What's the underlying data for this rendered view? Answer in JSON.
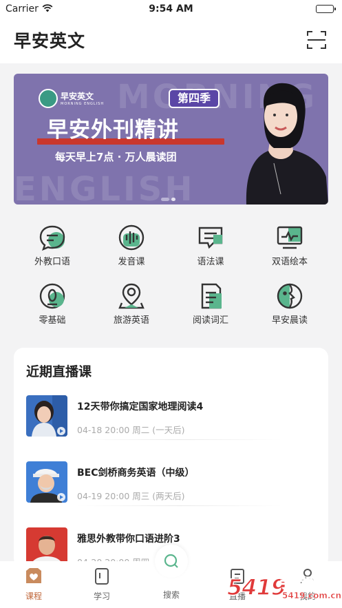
{
  "status_bar": {
    "carrier": "Carrier",
    "time": "9:54 AM"
  },
  "header": {
    "title": "早安英文",
    "scan_icon": "scan-icon"
  },
  "banner": {
    "brand": "早安英文",
    "brand_sub": "MORNING ENGLISH",
    "season": "第四季",
    "headline": "早安外刊精讲",
    "subhead": "每天早上7点 · 万人晨读团",
    "watermark_top": "MORNING",
    "watermark_bottom": "ENGLISH",
    "active_slide": 1,
    "slide_count": 2
  },
  "categories": [
    {
      "label": "外教口语",
      "icon": "chat-bubble-icon"
    },
    {
      "label": "发音课",
      "icon": "soundwave-icon"
    },
    {
      "label": "语法课",
      "icon": "message-lines-icon"
    },
    {
      "label": "双语绘本",
      "icon": "monitor-pulse-icon"
    },
    {
      "label": "零基础",
      "icon": "zero-badge-icon"
    },
    {
      "label": "旅游英语",
      "icon": "location-pin-icon"
    },
    {
      "label": "阅读词汇",
      "icon": "document-icon"
    },
    {
      "label": "早安晨读",
      "icon": "face-profile-icon"
    }
  ],
  "live": {
    "title": "近期直播课",
    "courses": [
      {
        "title": "12天带你搞定国家地理阅读4",
        "time": "04-18 20:00 周二 (一天后)"
      },
      {
        "title": "BEC剑桥商务英语（中级）",
        "time": "04-19 20:00 周三 (两天后)"
      },
      {
        "title": "雅思外教带你口语进阶3",
        "time": "04-20 20:00 周四"
      }
    ]
  },
  "tabs": [
    {
      "label": "课程",
      "icon": "heart-box-icon",
      "active": true
    },
    {
      "label": "学习",
      "icon": "book-icon",
      "active": false
    },
    {
      "label": "搜索",
      "icon": "search-icon",
      "active": false
    },
    {
      "label": "直播",
      "icon": "broadcast-icon",
      "active": false
    },
    {
      "label": "我的",
      "icon": "user-icon",
      "active": false
    }
  ],
  "site_watermark": {
    "number": "5419",
    "name": "手游网",
    "url": "5419.com.cn"
  },
  "colors": {
    "accent_green": "#5ab58d",
    "accent_orange": "#c0673a",
    "banner_purple": "#7f73ad",
    "season_purple": "#5a46a6",
    "headline_red": "#c9372d"
  }
}
